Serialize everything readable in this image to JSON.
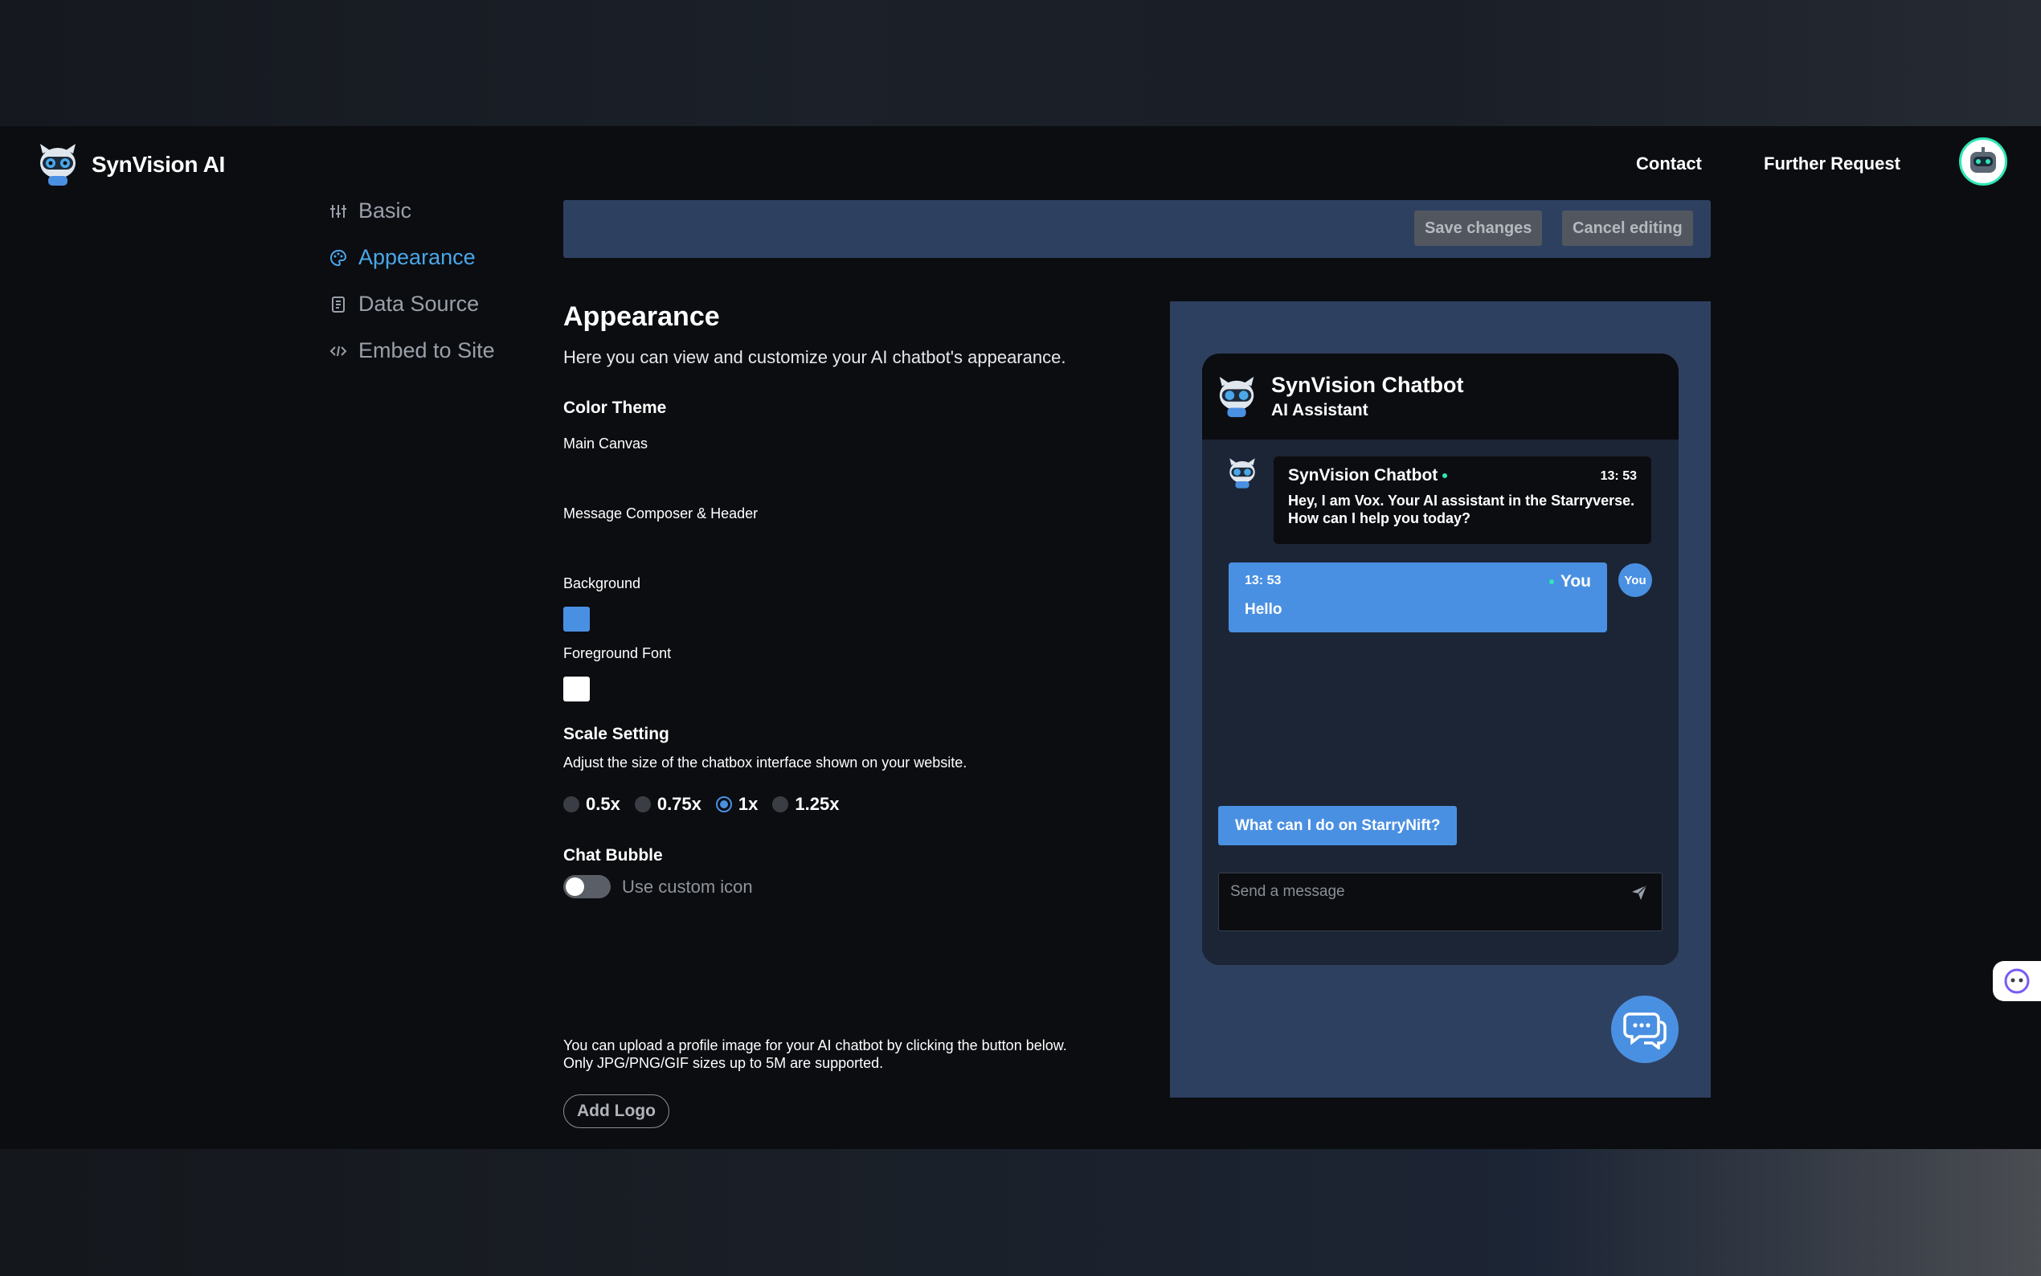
{
  "brand": {
    "name": "SynVision AI"
  },
  "topnav": {
    "contact": "Contact",
    "further_request": "Further Request"
  },
  "sidebar": {
    "items": [
      {
        "label": "Basic"
      },
      {
        "label": "Appearance"
      },
      {
        "label": "Data Source"
      },
      {
        "label": "Embed to Site"
      }
    ],
    "active": "Appearance"
  },
  "toolbar": {
    "save_label": "Save changes",
    "cancel_label": "Cancel editing"
  },
  "appearance": {
    "title": "Appearance",
    "description": "Here you can view and customize your AI chatbot's appearance.",
    "color_theme": {
      "title": "Color Theme",
      "main_canvas": "Main Canvas",
      "composer_header": "Message Composer & Header",
      "background_label": "Background",
      "background_color": "#4a90e2",
      "foreground_label": "Foreground Font",
      "foreground_color": "#ffffff"
    },
    "scale": {
      "title": "Scale Setting",
      "description": "Adjust the size of the chatbox interface shown on your website.",
      "options": [
        "0.5x",
        "0.75x",
        "1x",
        "1.25x"
      ],
      "selected": "1x"
    },
    "chat_bubble": {
      "title": "Chat Bubble",
      "toggle_label": "Use custom icon",
      "toggle_on": false,
      "upload_line1": "You can upload a profile image for your AI chatbot by clicking the button below.",
      "upload_line2": "Only JPG/PNG/GIF sizes up to 5M are supported.",
      "add_logo_label": "Add Logo"
    }
  },
  "preview": {
    "header_title": "SynVision Chatbot",
    "header_subtitle": "AI Assistant",
    "bot_message": {
      "name": "SynVision Chatbot",
      "time": "13: 53",
      "text": "Hey, I am Vox. Your AI assistant in the Starryverse. How can I help you today?"
    },
    "user_message": {
      "time": "13: 53",
      "name": "You",
      "text": "Hello"
    },
    "you_badge": "You",
    "suggestion": "What can I do on StarryNift?",
    "composer_placeholder": "Send a message"
  },
  "colors": {
    "accent": "#4a90e2",
    "panel": "#2e4060",
    "online": "#2ee8b5"
  }
}
